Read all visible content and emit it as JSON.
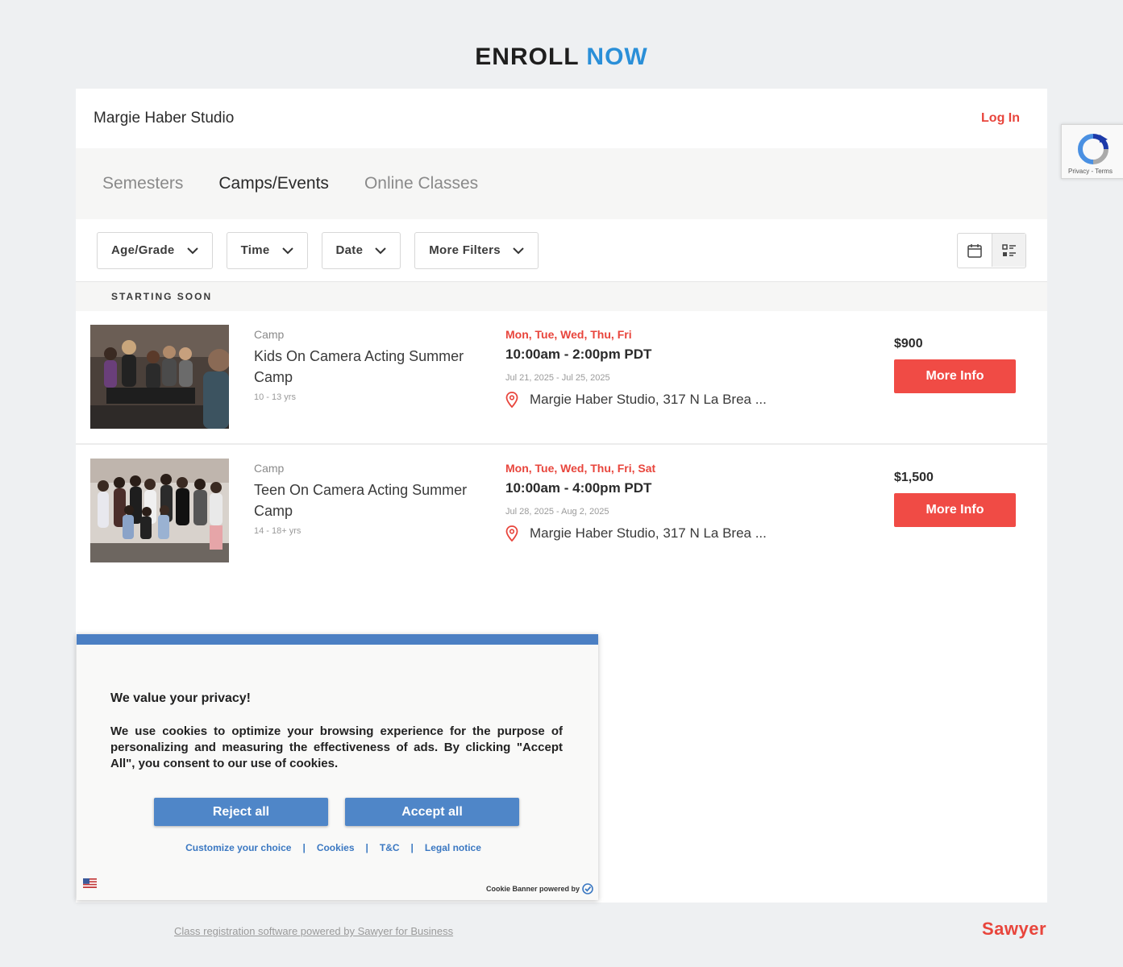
{
  "page": {
    "title_word1": "ENROLL",
    "title_word2": "NOW"
  },
  "header": {
    "studio_name": "Margie Haber Studio",
    "login_label": "Log In"
  },
  "tabs": [
    {
      "label": "Semesters",
      "active": false
    },
    {
      "label": "Camps/Events",
      "active": true
    },
    {
      "label": "Online Classes",
      "active": false
    }
  ],
  "filters": [
    {
      "label": "Age/Grade"
    },
    {
      "label": "Time"
    },
    {
      "label": "Date"
    },
    {
      "label": "More Filters"
    }
  ],
  "view_toggle": {
    "calendar_icon": "calendar-icon",
    "list_icon": "list-view-icon",
    "selected": "list"
  },
  "section_label": "STARTING SOON",
  "classes": [
    {
      "category": "Camp",
      "name": "Kids On Camera Acting Summer Camp",
      "age": "10 - 13 yrs",
      "days": "Mon, Tue, Wed, Thu, Fri",
      "time": "10:00am - 2:00pm PDT",
      "dates": "Jul 21, 2025 - Jul 25, 2025",
      "location": "Margie Haber Studio, 317 N La Brea ...",
      "price": "$900",
      "button_label": "More Info"
    },
    {
      "category": "Camp",
      "name": "Teen On Camera Acting Summer Camp",
      "age": "14 - 18+ yrs",
      "days": "Mon, Tue, Wed, Thu, Fri, Sat",
      "time": "10:00am - 4:00pm PDT",
      "dates": "Jul 28, 2025 - Aug 2, 2025",
      "location": "Margie Haber Studio, 317 N La Brea ...",
      "price": "$1,500",
      "button_label": "More Info"
    }
  ],
  "cookie_banner": {
    "title": "We value your privacy!",
    "text": "We use cookies to optimize your browsing experience for the purpose of personalizing and measuring the effectiveness of ads. By clicking \"Accept All\", you consent to our use of cookies.",
    "reject_label": "Reject all",
    "accept_label": "Accept all",
    "links": {
      "customize": "Customize your choice",
      "cookies": "Cookies",
      "tc": "T&C",
      "legal": "Legal notice",
      "separator": "|"
    },
    "powered_by": "Cookie Banner powered by"
  },
  "recaptcha": {
    "text": "Privacy - Terms"
  },
  "footer": {
    "powered_link": "Class registration software powered by Sawyer for Business",
    "brand": "Sawyer"
  },
  "colors": {
    "accent_red": "#e8453c",
    "accent_blue": "#2a8fd8",
    "cookie_blue": "#4f86c8"
  }
}
